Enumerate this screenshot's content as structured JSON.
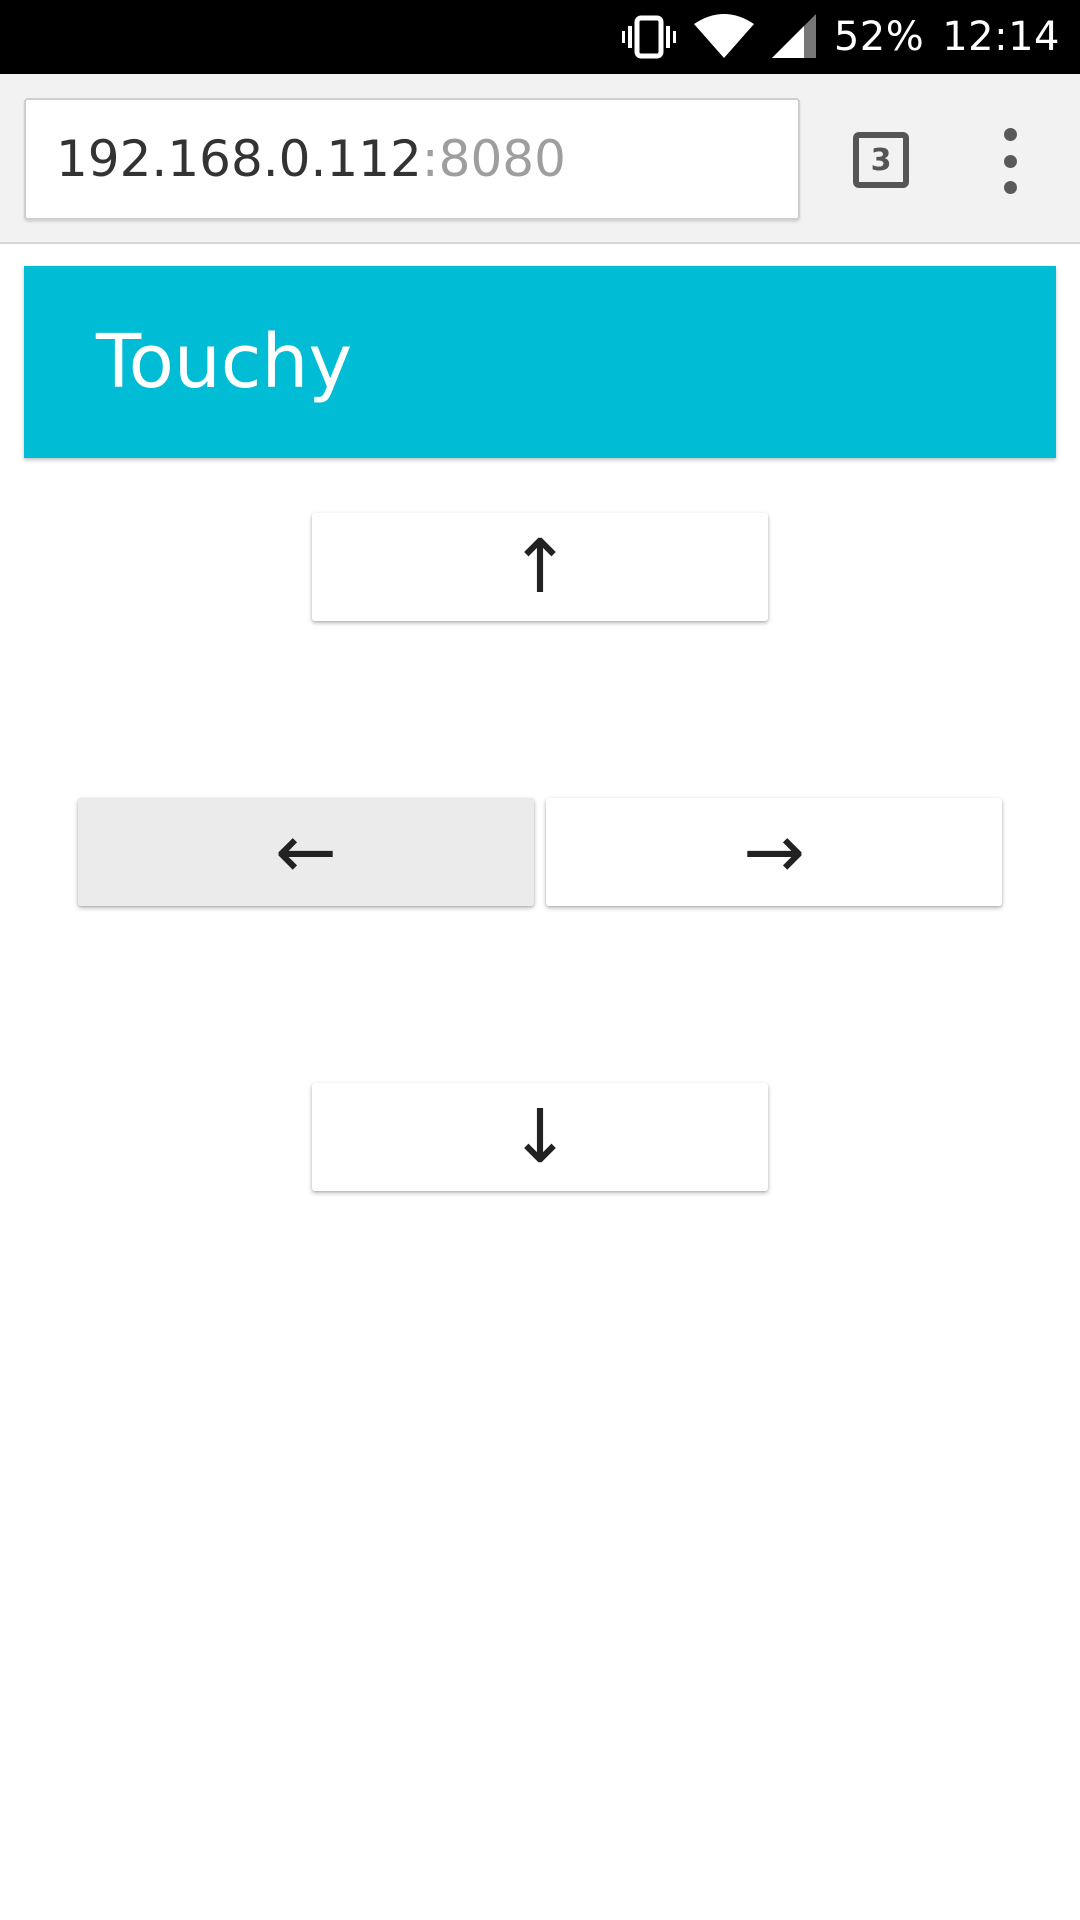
{
  "status_bar": {
    "battery": "52%",
    "time": "12:14",
    "icons": [
      "vibrate-icon",
      "wifi-icon",
      "signal-icon"
    ]
  },
  "browser": {
    "url_host": "192.168.0.112",
    "url_port": ":8080",
    "tab_count": "3",
    "menu_icon": "overflow-menu-icon"
  },
  "app": {
    "title": "Touchy",
    "header_color": "#00bcd4"
  },
  "controls": {
    "up": "↑",
    "left": "←",
    "right": "→",
    "down": "↓",
    "pressed": "left"
  }
}
